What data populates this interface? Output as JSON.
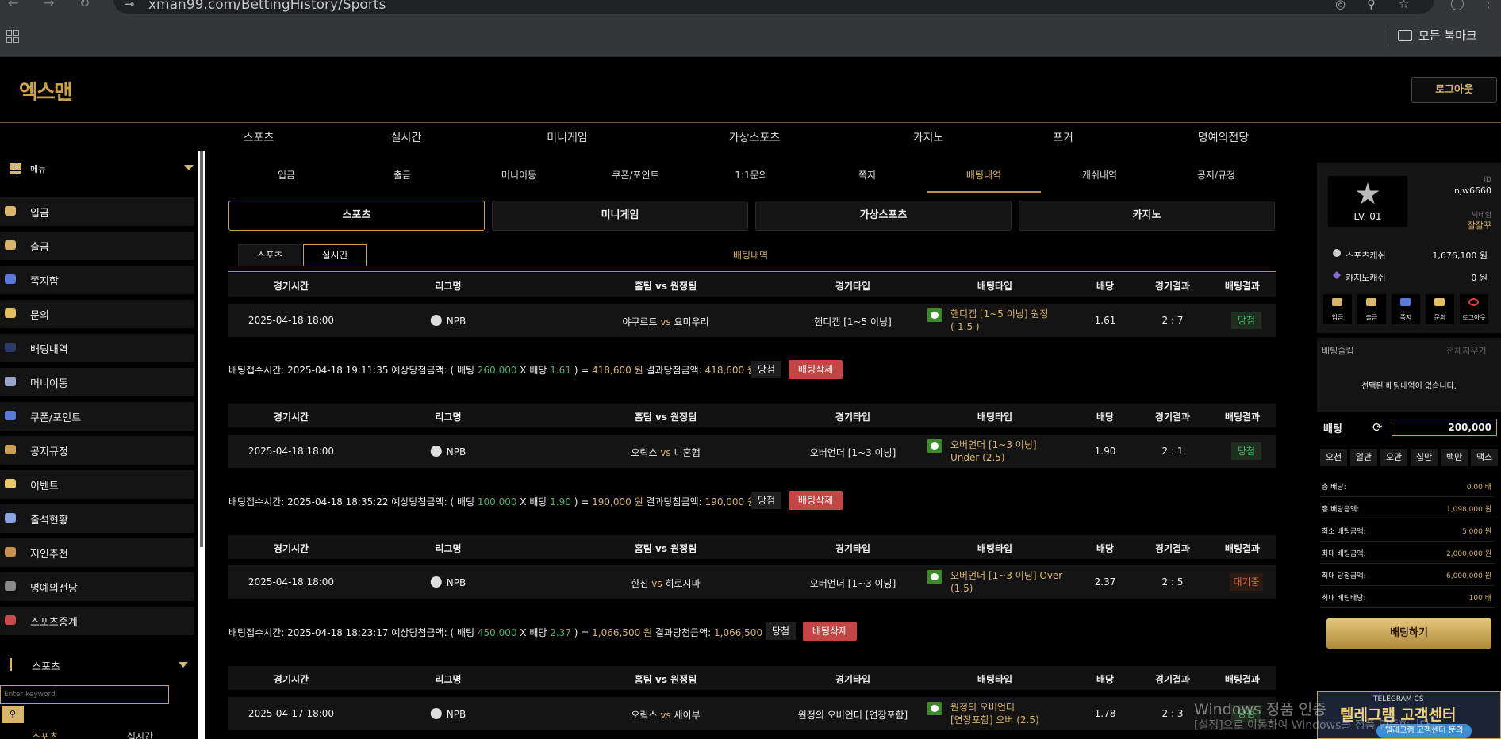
{
  "browser": {
    "url": "xman99.com/BettingHistory/Sports",
    "bookmarks_label": "모든 북마크"
  },
  "site": {
    "logo": "엑스맨",
    "logout": "로그아웃"
  },
  "topnav": [
    "스포츠",
    "실시간",
    "미니게임",
    "가상스포츠",
    "카지노",
    "포커",
    "명예의전당"
  ],
  "subnav": [
    "입금",
    "출금",
    "머니이동",
    "쿠폰/포인트",
    "1:1문의",
    "쪽지",
    "배팅내역",
    "캐쉬내역",
    "공지/규정"
  ],
  "sidebar": {
    "menu_label": "메뉴",
    "items": [
      "입금",
      "출금",
      "쪽지함",
      "문의",
      "배팅내역",
      "머니이동",
      "쿠폰/포인트",
      "공지규정",
      "이벤트",
      "출석현황",
      "지인추천",
      "명예의전당",
      "스포츠중계"
    ],
    "sports_label": "스포츠",
    "keyword_placeholder": "Enter keyword",
    "bottom_left": "스포츠",
    "bottom_right": "실시간"
  },
  "categories": [
    "스포츠",
    "미니게임",
    "가상스포츠",
    "카지노"
  ],
  "subtabs": [
    "스포츠",
    "실시간"
  ],
  "history_title": "배팅내역",
  "table_headers": [
    "경기시간",
    "리그명",
    "홈팀 vs 원정팀",
    "경기타입",
    "배팅타입",
    "배당",
    "경기결과",
    "배팅결과"
  ],
  "bets": [
    {
      "time": "2025-04-18 18:00",
      "league": "NPB",
      "home": "야쿠르트",
      "vs": "vs",
      "away": "요미우리",
      "game_type": "핸디캡 [1~5 이닝]",
      "bet_type_1": "핸디캡 [1~5 이닝] 원정",
      "bet_type_2": "(-1.5 )",
      "odds": "1.61",
      "score": "2 : 7",
      "result": "당첨",
      "summary": {
        "p1": "배팅접수시간: 2025-04-18 19:11:35  예상당첨금액: ( 배팅 ",
        "stake": "260,000",
        "p2": " X 배당 ",
        "odds": "1.61",
        "p3": " ) = ",
        "expected": "418,600 원",
        "p4": "  결과당첨금액: ",
        "actual": "418,600 원"
      },
      "win_btn": "당첨",
      "del_btn": "배팅삭제"
    },
    {
      "time": "2025-04-18 18:00",
      "league": "NPB",
      "home": "오릭스",
      "vs": "vs",
      "away": "니혼햄",
      "game_type": "오버언더 [1~3 이닝]",
      "bet_type_1": "오버언더 [1~3 이닝]",
      "bet_type_2": "Under (2.5)",
      "odds": "1.90",
      "score": "2 : 1",
      "result": "당첨",
      "summary": {
        "p1": "배팅접수시간: 2025-04-18 18:35:22  예상당첨금액: ( 배팅 ",
        "stake": "100,000",
        "p2": " X 배당 ",
        "odds": "1.90",
        "p3": " ) = ",
        "expected": "190,000 원",
        "p4": "  결과당첨금액: ",
        "actual": "190,000 원"
      },
      "win_btn": "당첨",
      "del_btn": "배팅삭제"
    },
    {
      "time": "2025-04-18 18:00",
      "league": "NPB",
      "home": "한신",
      "vs": "vs",
      "away": "히로시마",
      "game_type": "오버언더 [1~3 이닝]",
      "bet_type_1": "오버언더 [1~3 이닝] Over",
      "bet_type_2": "(1.5)",
      "odds": "2.37",
      "score": "2 : 5",
      "result": "대기중",
      "summary": {
        "p1": "배팅접수시간: 2025-04-18 18:23:17  예상당첨금액: ( 배팅 ",
        "stake": "450,000",
        "p2": " X 배당 ",
        "odds": "2.37",
        "p3": " ) = ",
        "expected": "1,066,500 원",
        "p4": "  결과당첨금액: ",
        "actual": "1,066,500 원"
      },
      "win_btn": "당첨",
      "del_btn": "배팅삭제"
    },
    {
      "time": "2025-04-17 18:00",
      "league": "NPB",
      "home": "오릭스",
      "vs": "vs",
      "away": "세이부",
      "game_type": "원정의 오버언더 [연장포함]",
      "bet_type_1": "원정의 오버언더",
      "bet_type_2": "[연장포함] 오버 (2.5)",
      "odds": "1.78",
      "score": "2 : 3",
      "result": "당첨"
    }
  ],
  "right_panel": {
    "level": "LV. 01",
    "id_label": "ID",
    "id_value": "njw6660",
    "nick_label": "닉네임",
    "nick_value": "잘잘꾸",
    "sports_money_label": "스포츠캐쉬",
    "sports_money": "1,676,100 원",
    "casino_money_label": "카지노캐쉬",
    "casino_money": "0 원",
    "mini_buttons": [
      "입금",
      "출금",
      "쪽지",
      "문의",
      "로그아웃"
    ],
    "betslip_label": "배팅슬립",
    "clear_all": "전체지우기",
    "empty_msg": "선택된 배팅내역이 없습니다.",
    "bet_label": "배팅",
    "bet_amount": "200,000",
    "quick": [
      "오천",
      "일만",
      "오만",
      "십만",
      "백만",
      "맥스"
    ],
    "stats": [
      {
        "k": "총 배당:",
        "v": "0.00 배"
      },
      {
        "k": "총 배당금액:",
        "v": "1,098,000 원"
      },
      {
        "k": "최소 배팅금액:",
        "v": "5,000 원"
      },
      {
        "k": "최대 배팅금액:",
        "v": "2,000,000 원"
      },
      {
        "k": "최대 당첨금액:",
        "v": "6,000,000 원"
      },
      {
        "k": "최대 배팅배당:",
        "v": "100 배"
      }
    ],
    "bet_button": "배팅하기",
    "telegram_small": "TELEGRAM CS",
    "telegram_big": "텔레그램 고객센터",
    "telegram_btn": "텔레그램 고객센터 문의"
  },
  "watermark": {
    "line1": "Windows 정품 인증",
    "line2": "[설정]으로 이동하여 Windows를 정품 인증합니다."
  }
}
